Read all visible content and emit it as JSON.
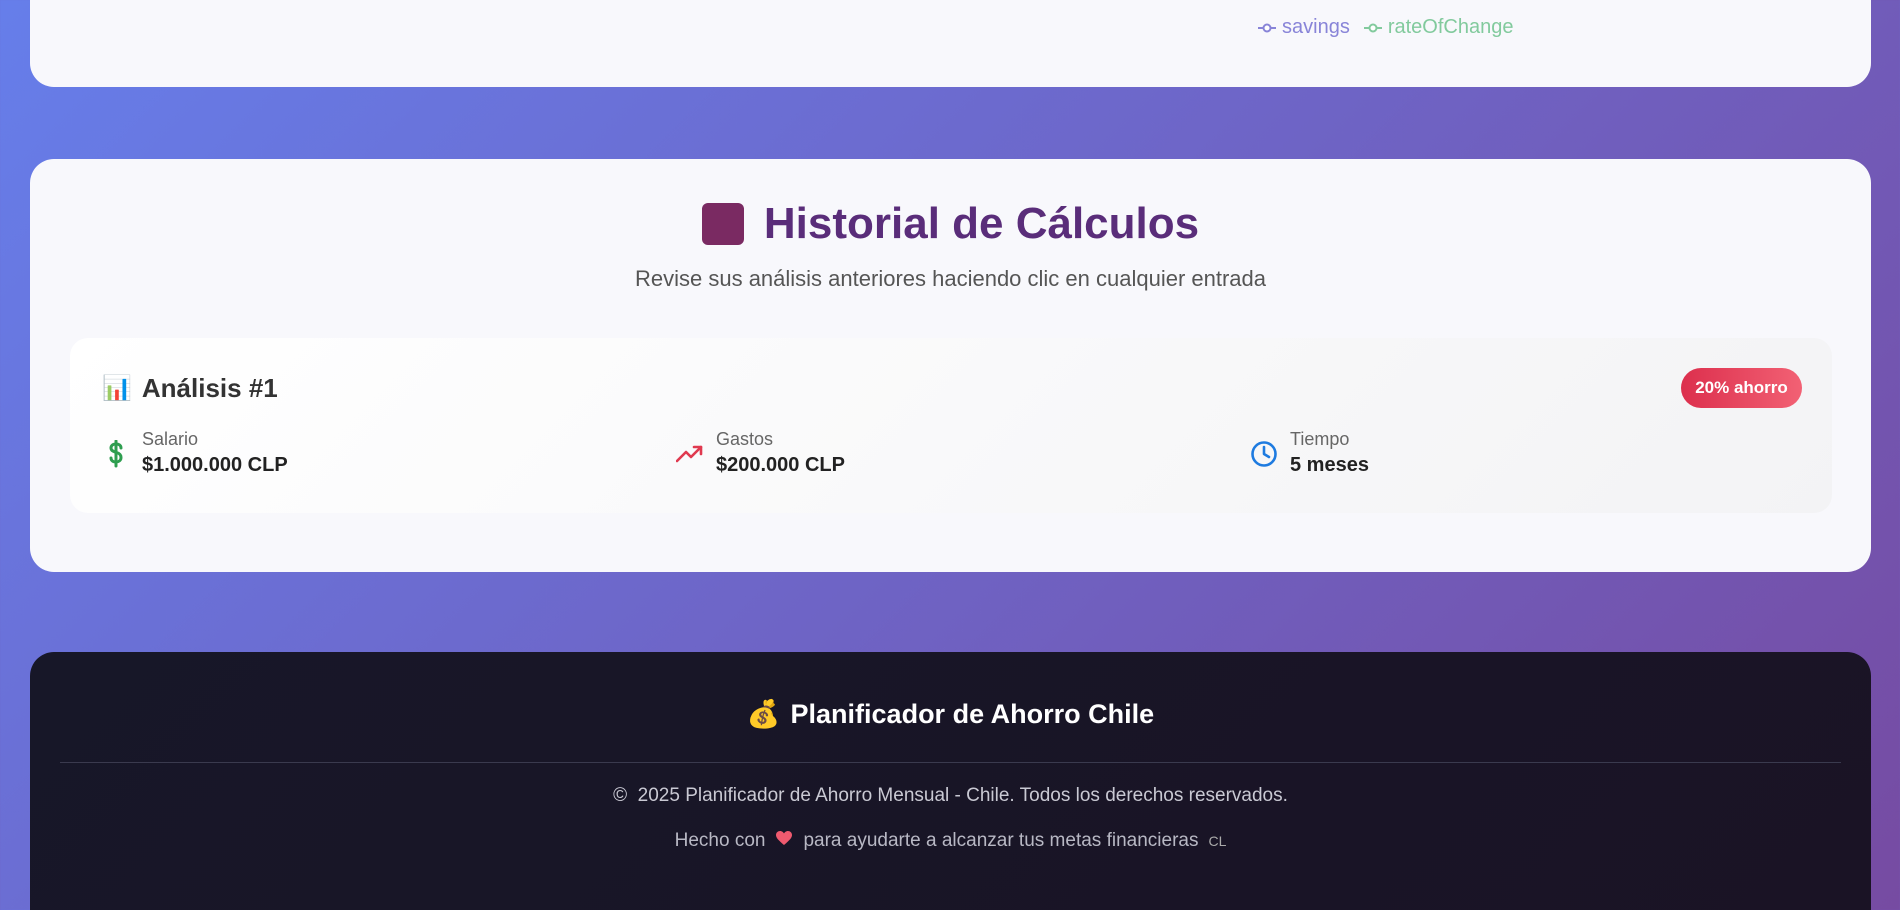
{
  "chart_legend": {
    "items": [
      {
        "label": "savings",
        "color": "#8884d8"
      },
      {
        "label": "rateOfChange",
        "color": "#82ca9d"
      }
    ]
  },
  "history": {
    "title": "Historial de Cálculos",
    "subtitle": "Revise sus análisis anteriores haciendo clic en cualquier entrada",
    "entries": [
      {
        "icon": "📊",
        "name": "Análisis #1",
        "badge": "20% ahorro",
        "salary_label": "Salario",
        "salary_value": "$1.000.000 CLP",
        "expenses_label": "Gastos",
        "expenses_value": "$200.000 CLP",
        "time_label": "Tiempo",
        "time_value": "5 meses"
      }
    ]
  },
  "footer": {
    "icon": "💰",
    "title": "Planificador de Ahorro Chile",
    "copyright": "2025 Planificador de Ahorro Mensual - Chile. Todos los derechos reservados.",
    "made_prefix": "Hecho con",
    "made_suffix": "para ayudarte a alcanzar tus metas financieras",
    "flag": "CL"
  },
  "colors": {
    "title": "#5a2d7a",
    "badge": "#dc2f4d",
    "salary_icon": "#2e9e4f",
    "expenses_icon": "#e0394f",
    "time_icon": "#1e7be0"
  }
}
